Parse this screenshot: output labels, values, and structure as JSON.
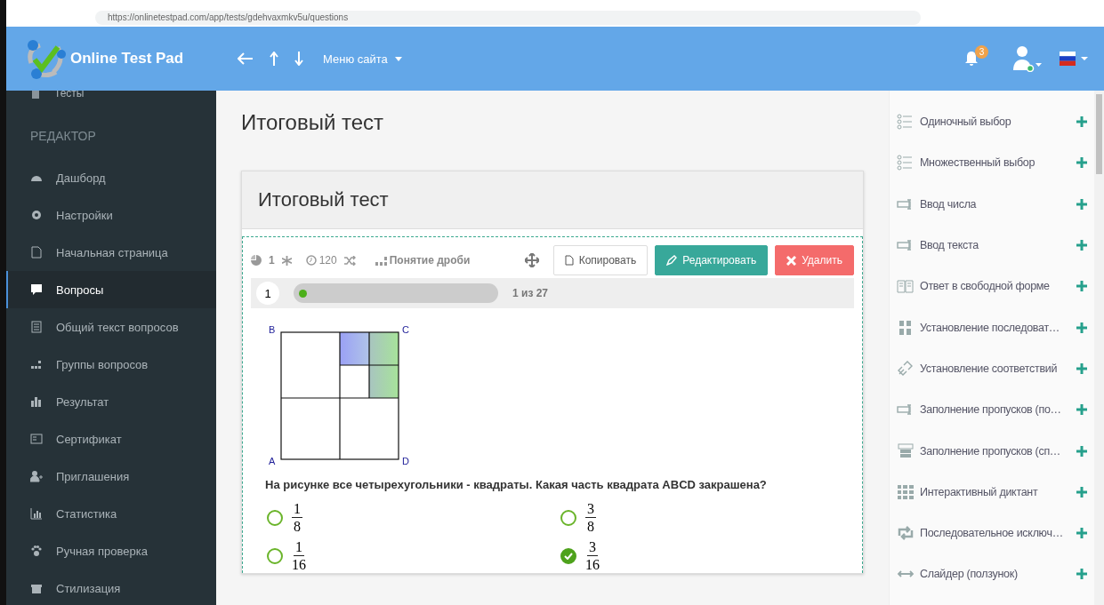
{
  "browser": {
    "url": "https://onlinetestpad.com/app/tests/gdehvaxmkv5u/questions"
  },
  "header": {
    "brand": "Online Test Pad",
    "menu": "Меню сайта",
    "notifications": "3"
  },
  "sidebar": {
    "top_item": "Тесты",
    "section": "РЕДАКТОР",
    "items": [
      {
        "label": "Дашборд",
        "kind": "dashboard",
        "selected": false
      },
      {
        "label": "Настройки",
        "kind": "gear",
        "selected": false
      },
      {
        "label": "Начальная страница",
        "kind": "page",
        "selected": false
      },
      {
        "label": "Вопросы",
        "kind": "question",
        "selected": true
      },
      {
        "label": "Общий текст вопросов",
        "kind": "document",
        "selected": false
      },
      {
        "label": "Группы вопросов",
        "kind": "groups",
        "selected": false
      },
      {
        "label": "Результат",
        "kind": "bars",
        "selected": false
      },
      {
        "label": "Сертификат",
        "kind": "certificate",
        "selected": false
      },
      {
        "label": "Приглашения",
        "kind": "userplus",
        "selected": false
      },
      {
        "label": "Статистика",
        "kind": "chart",
        "selected": false
      },
      {
        "label": "Ручная проверка",
        "kind": "paw",
        "selected": false
      },
      {
        "label": "Стилизация",
        "kind": "gift",
        "selected": false
      }
    ]
  },
  "page_title": "Итоговый тест",
  "card": {
    "title": "Итоговый тест",
    "meta": {
      "points": "1",
      "time": "120",
      "group": "Понятие дроби"
    },
    "buttons": [
      {
        "label": "Копировать",
        "kind": "copy"
      },
      {
        "label": "Редактировать",
        "kind": "edit"
      },
      {
        "label": "Удалить",
        "kind": "delete"
      }
    ],
    "question": {
      "number": "1",
      "progress": {
        "level": 0.04,
        "text": "1 из 27"
      },
      "vertices": [
        "B",
        "C",
        "A",
        "D"
      ],
      "text": "На рисунке все четырехугольники - квадраты. Какая часть квадрата ABCD закрашена?",
      "options": [
        {
          "numerator": "1",
          "denominator": "8",
          "selected": false
        },
        {
          "numerator": "3",
          "denominator": "8",
          "selected": false
        },
        {
          "numerator": "1",
          "denominator": "16",
          "selected": false
        },
        {
          "numerator": "3",
          "denominator": "16",
          "selected": true
        }
      ]
    }
  },
  "question_types": [
    {
      "label": "Одиночный выбор",
      "kind": "list"
    },
    {
      "label": "Множественный выбор",
      "kind": "list"
    },
    {
      "label": "Ввод числа",
      "kind": "input"
    },
    {
      "label": "Ввод текста",
      "kind": "input"
    },
    {
      "label": "Ответ в свободной форме",
      "kind": "book"
    },
    {
      "label": "Установление последоват…",
      "kind": "sequence"
    },
    {
      "label": "Установление соответствий",
      "kind": "link"
    },
    {
      "label": "Заполнение пропусков (по…",
      "kind": "input"
    },
    {
      "label": "Заполнение пропусков (сп…",
      "kind": "dropdown"
    },
    {
      "label": "Интерактивный диктант",
      "kind": "grid"
    },
    {
      "label": "Последовательное исключ…",
      "kind": "cycle"
    },
    {
      "label": "Слайдер (ползунок)",
      "kind": "slider"
    }
  ]
}
